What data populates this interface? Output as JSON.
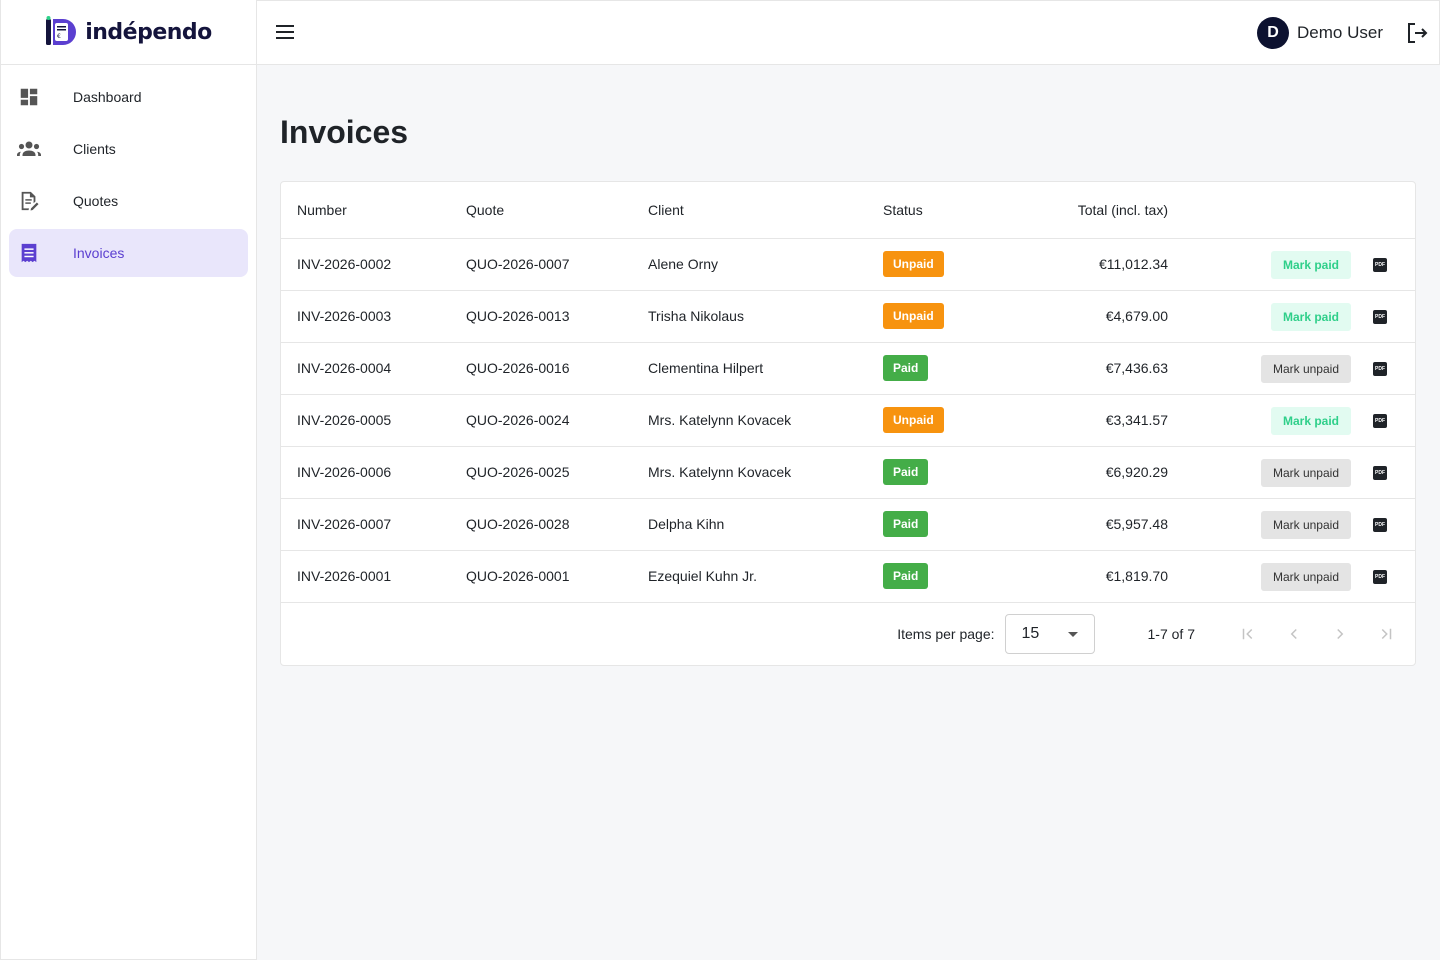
{
  "app": {
    "brand": "indépendo"
  },
  "sidebar": {
    "items": [
      {
        "label": "Dashboard",
        "icon": "dashboard-icon",
        "active": false
      },
      {
        "label": "Clients",
        "icon": "people-icon",
        "active": false
      },
      {
        "label": "Quotes",
        "icon": "edit-document-icon",
        "active": false
      },
      {
        "label": "Invoices",
        "icon": "receipt-icon",
        "active": true
      }
    ]
  },
  "header": {
    "user_initial": "D",
    "user_name": "Demo User"
  },
  "page": {
    "title": "Invoices"
  },
  "table": {
    "columns": [
      "Number",
      "Quote",
      "Client",
      "Status",
      "Total (incl. tax)"
    ],
    "rows": [
      {
        "number": "INV-2026-0002",
        "quote": "QUO-2026-0007",
        "client": "Alene Orny",
        "status": "Unpaid",
        "total": "€11,012.34",
        "action": "Mark paid"
      },
      {
        "number": "INV-2026-0003",
        "quote": "QUO-2026-0013",
        "client": "Trisha Nikolaus",
        "status": "Unpaid",
        "total": "€4,679.00",
        "action": "Mark paid"
      },
      {
        "number": "INV-2026-0004",
        "quote": "QUO-2026-0016",
        "client": "Clementina Hilpert",
        "status": "Paid",
        "total": "€7,436.63",
        "action": "Mark unpaid"
      },
      {
        "number": "INV-2026-0005",
        "quote": "QUO-2026-0024",
        "client": "Mrs. Katelynn Kovacek",
        "status": "Unpaid",
        "total": "€3,341.57",
        "action": "Mark paid"
      },
      {
        "number": "INV-2026-0006",
        "quote": "QUO-2026-0025",
        "client": "Mrs. Katelynn Kovacek",
        "status": "Paid",
        "total": "€6,920.29",
        "action": "Mark unpaid"
      },
      {
        "number": "INV-2026-0007",
        "quote": "QUO-2026-0028",
        "client": "Delpha Kihn",
        "status": "Paid",
        "total": "€5,957.48",
        "action": "Mark unpaid"
      },
      {
        "number": "INV-2026-0001",
        "quote": "QUO-2026-0001",
        "client": "Ezequiel Kuhn Jr.",
        "status": "Paid",
        "total": "€1,819.70",
        "action": "Mark unpaid"
      }
    ],
    "pdf_label": "PDF"
  },
  "paginator": {
    "items_per_page_label": "Items per page:",
    "page_size": "15",
    "range": "1-7 of 7"
  },
  "colors": {
    "accent": "#5b3fd0",
    "active_nav_bg": "#e9e6fb",
    "unpaid": "#f7930f",
    "paid": "#44ad48",
    "mark_paid_text": "#2fcf8a",
    "mark_paid_bg": "#e2fbf1"
  }
}
